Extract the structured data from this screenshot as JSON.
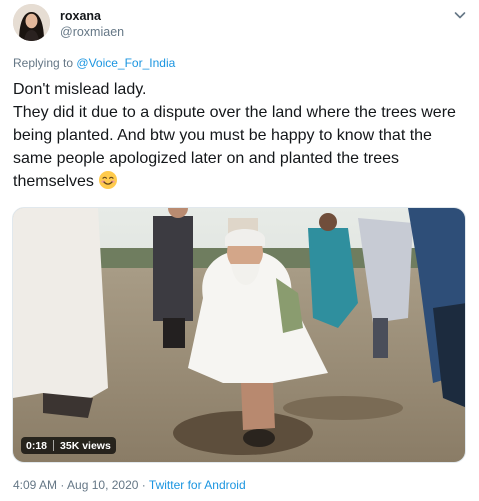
{
  "author": {
    "name": "roxana",
    "handle": "@roxmiaen"
  },
  "replying": {
    "prefix": "Replying to",
    "mention": "@Voice_For_India"
  },
  "tweet": {
    "text": "Don't mislead lady.\nThey did it due to a dispute over the land where the trees were being planted. And btw you must be happy to know that the same people apologized later on and planted the trees themselves",
    "emoji": "smiling-face-with-smiling-eyes"
  },
  "video": {
    "duration": "0:18",
    "views": "35K views"
  },
  "meta": {
    "time": "4:09 AM",
    "dot1": "·",
    "date": "Aug 10, 2020",
    "dot2": "·",
    "source": "Twitter for Android"
  },
  "icons": {
    "caret": "chevron-down-icon",
    "avatar": "avatar"
  },
  "colors": {
    "link": "#1b95e0",
    "secondary_text": "#657786",
    "primary_text": "#14171a"
  }
}
